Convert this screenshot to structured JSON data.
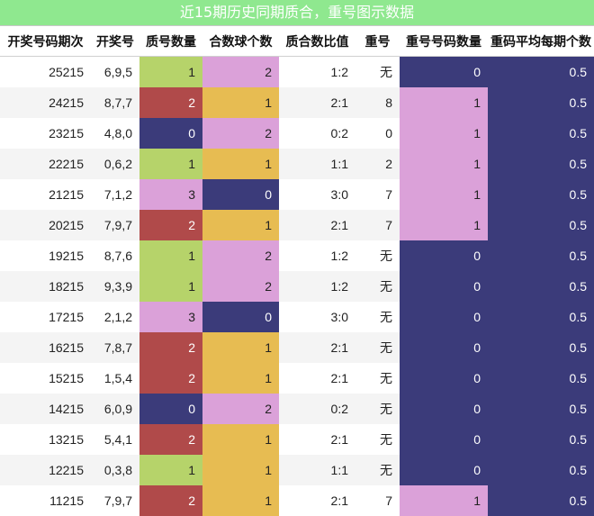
{
  "title": "近15期历史同期质合，重号图示数据",
  "columns": [
    "开奖号码期次",
    "开奖号",
    "质号数量",
    "合数球个数",
    "质合数比值",
    "重号",
    "重号号码数量",
    "重码平均每期个数"
  ],
  "rows": [
    {
      "period": "25215",
      "numbers": "6,9,5",
      "prime": "1",
      "composite": "2",
      "ratio": "1:2",
      "repeat": "无",
      "repeat_count": "0",
      "avg": "0.5"
    },
    {
      "period": "24215",
      "numbers": "8,7,7",
      "prime": "2",
      "composite": "1",
      "ratio": "2:1",
      "repeat": "8",
      "repeat_count": "1",
      "avg": "0.5"
    },
    {
      "period": "23215",
      "numbers": "4,8,0",
      "prime": "0",
      "composite": "2",
      "ratio": "0:2",
      "repeat": "0",
      "repeat_count": "1",
      "avg": "0.5"
    },
    {
      "period": "22215",
      "numbers": "0,6,2",
      "prime": "1",
      "composite": "1",
      "ratio": "1:1",
      "repeat": "2",
      "repeat_count": "1",
      "avg": "0.5"
    },
    {
      "period": "21215",
      "numbers": "7,1,2",
      "prime": "3",
      "composite": "0",
      "ratio": "3:0",
      "repeat": "7",
      "repeat_count": "1",
      "avg": "0.5"
    },
    {
      "period": "20215",
      "numbers": "7,9,7",
      "prime": "2",
      "composite": "1",
      "ratio": "2:1",
      "repeat": "7",
      "repeat_count": "1",
      "avg": "0.5"
    },
    {
      "period": "19215",
      "numbers": "8,7,6",
      "prime": "1",
      "composite": "2",
      "ratio": "1:2",
      "repeat": "无",
      "repeat_count": "0",
      "avg": "0.5"
    },
    {
      "period": "18215",
      "numbers": "9,3,9",
      "prime": "1",
      "composite": "2",
      "ratio": "1:2",
      "repeat": "无",
      "repeat_count": "0",
      "avg": "0.5"
    },
    {
      "period": "17215",
      "numbers": "2,1,2",
      "prime": "3",
      "composite": "0",
      "ratio": "3:0",
      "repeat": "无",
      "repeat_count": "0",
      "avg": "0.5"
    },
    {
      "period": "16215",
      "numbers": "7,8,7",
      "prime": "2",
      "composite": "1",
      "ratio": "2:1",
      "repeat": "无",
      "repeat_count": "0",
      "avg": "0.5"
    },
    {
      "period": "15215",
      "numbers": "1,5,4",
      "prime": "2",
      "composite": "1",
      "ratio": "2:1",
      "repeat": "无",
      "repeat_count": "0",
      "avg": "0.5"
    },
    {
      "period": "14215",
      "numbers": "6,0,9",
      "prime": "0",
      "composite": "2",
      "ratio": "0:2",
      "repeat": "无",
      "repeat_count": "0",
      "avg": "0.5"
    },
    {
      "period": "13215",
      "numbers": "5,4,1",
      "prime": "2",
      "composite": "1",
      "ratio": "2:1",
      "repeat": "无",
      "repeat_count": "0",
      "avg": "0.5"
    },
    {
      "period": "12215",
      "numbers": "0,3,8",
      "prime": "1",
      "composite": "1",
      "ratio": "1:1",
      "repeat": "无",
      "repeat_count": "0",
      "avg": "0.5"
    },
    {
      "period": "11215",
      "numbers": "7,9,7",
      "prime": "2",
      "composite": "1",
      "ratio": "2:1",
      "repeat": "7",
      "repeat_count": "1",
      "avg": "0.5"
    }
  ],
  "cell_colors": {
    "value_0": "#3b3b7a",
    "value_1_primary": "#b6d36a",
    "value_1_secondary": "#e7bc52",
    "value_1_repeat": "#dba1d9",
    "value_2_primary": "#b04a4a",
    "value_2_secondary": "#dba1d9",
    "value_3": "#dba1d9",
    "average": "#3b3b7a"
  }
}
